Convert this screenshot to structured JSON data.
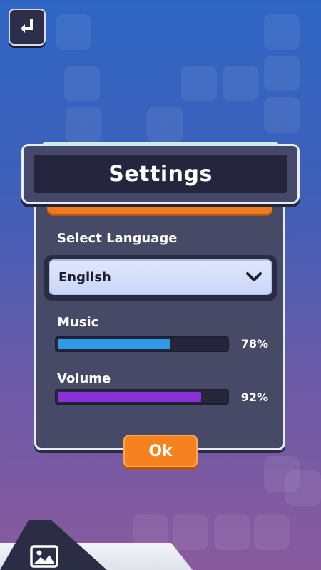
{
  "dialog": {
    "title": "Settings",
    "language_label": "Select Language",
    "language_value": "English",
    "music": {
      "label": "Music",
      "value_text": "78%",
      "value": 0.67,
      "color": "#2f9be8"
    },
    "volume": {
      "label": "Volume",
      "value_text": "92%",
      "value": 0.85,
      "color": "#8b2fd6"
    },
    "ok_label": "Ok"
  },
  "icons": {
    "back": "return-arrow-icon",
    "dropdown": "chevron-down-icon",
    "gallery": "image-icon"
  },
  "colors": {
    "accent_orange": "#f5821f",
    "panel": "#474a66",
    "title_bg": "#25263d"
  }
}
